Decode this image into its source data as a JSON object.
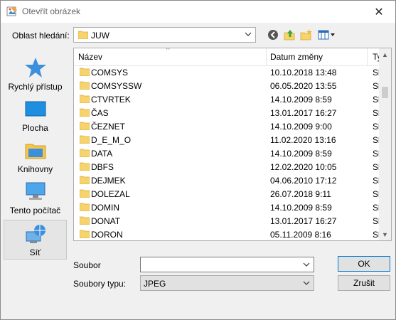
{
  "window": {
    "title": "Otevřít obrázek",
    "close_glyph": "✕"
  },
  "lookin": {
    "label": "Oblast hledání:",
    "value": "JUW"
  },
  "toolbar": {
    "back": "back-icon",
    "up": "up-folder-icon",
    "new_folder": "new-folder-icon",
    "view": "view-menu-icon"
  },
  "places": [
    {
      "label": "Rychlý přístup",
      "icon": "star-icon"
    },
    {
      "label": "Plocha",
      "icon": "desktop-icon"
    },
    {
      "label": "Knihovny",
      "icon": "libraries-icon"
    },
    {
      "label": "Tento počítač",
      "icon": "computer-icon"
    },
    {
      "label": "Síť",
      "icon": "network-icon",
      "selected": true
    }
  ],
  "columns": {
    "name": "Název",
    "date": "Datum změny",
    "type": "Ty"
  },
  "files": [
    {
      "name": "COMSYS",
      "date": "10.10.2018 13:48",
      "type": "Sl"
    },
    {
      "name": "COMSYSSW",
      "date": "06.05.2020 13:55",
      "type": "Sl"
    },
    {
      "name": "CTVRTEK",
      "date": "14.10.2009 8:59",
      "type": "Sl"
    },
    {
      "name": "ČAS",
      "date": "13.01.2017 16:27",
      "type": "Sl"
    },
    {
      "name": "ČEZNET",
      "date": "14.10.2009 9:00",
      "type": "Sl"
    },
    {
      "name": "D_E_M_O",
      "date": "11.02.2020 13:16",
      "type": "Sl"
    },
    {
      "name": "DATA",
      "date": "14.10.2009 8:59",
      "type": "Sl"
    },
    {
      "name": "DBFS",
      "date": "12.02.2020 10:05",
      "type": "Sl"
    },
    {
      "name": "DEJMEK",
      "date": "04.06.2010 17:12",
      "type": "Sl"
    },
    {
      "name": "DOLEZAL",
      "date": "26.07.2018 9:11",
      "type": "Sl"
    },
    {
      "name": "DOMIN",
      "date": "14.10.2009 8:59",
      "type": "Sl"
    },
    {
      "name": "DONAT",
      "date": "13.01.2017 16:27",
      "type": "Sl"
    },
    {
      "name": "DORON",
      "date": "05.11.2009 8:16",
      "type": "Sl"
    }
  ],
  "filename": {
    "label": "Soubor",
    "value": ""
  },
  "filetype": {
    "label": "Soubory typu:",
    "value": "JPEG"
  },
  "buttons": {
    "ok": "OK",
    "cancel": "Zrušit"
  },
  "colors": {
    "folder": "#f7d36b",
    "selection": "#e5e5e5",
    "accent": "#0078d7"
  }
}
